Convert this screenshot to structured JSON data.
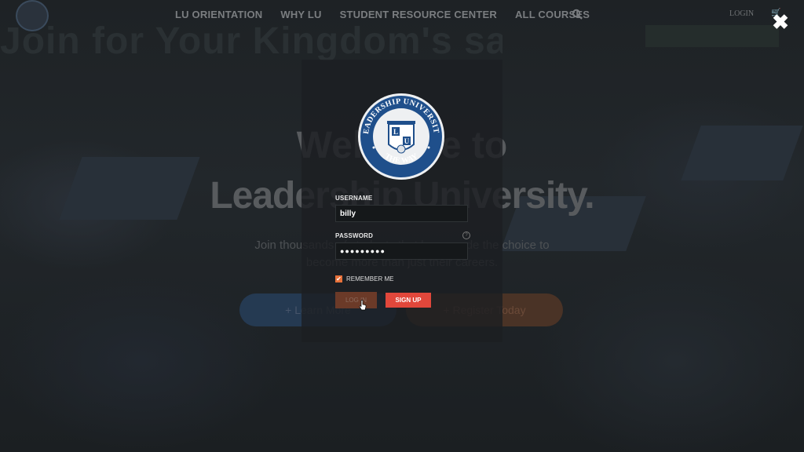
{
  "nav": {
    "items": [
      "LU ORIENTATION",
      "WHY LU",
      "STUDENT RESOURCE CENTER",
      "ALL COURSES"
    ],
    "search_icon": "search-icon",
    "login": "LOGIN",
    "cart_icon": "cart-icon",
    "close_icon": "close-icon"
  },
  "background": {
    "banner_text": "Join for Your Kingdom's sake",
    "hero_title_line1": "Welcome to",
    "hero_title_line2": "Leadership University.",
    "hero_subtitle_line1": "Join thousands of students that have made the choice to",
    "hero_subtitle_line2": "become more than just their careers.",
    "learn_more_label": "+ Learn More",
    "register_label": "+ Register Today"
  },
  "seal": {
    "top_text": "LEADERSHIP UNIVERSITY",
    "bottom_text": "THE WAY",
    "letters": [
      "L",
      "U"
    ],
    "colors": {
      "blue": "#1f4f8b",
      "cream": "#eef0f2"
    }
  },
  "login_form": {
    "username_label": "USERNAME",
    "username_value": "billy",
    "password_label": "PASSWORD",
    "password_value": "●●●●●●●●●",
    "help_icon": "?",
    "remember_label": "REMEMBER ME",
    "remember_checked": true,
    "login_button": "LOG IN",
    "signup_button": "SIGN UP",
    "colors": {
      "accent": "#e7713a",
      "signup": "#e1473b",
      "login": "#6b3a28"
    }
  }
}
